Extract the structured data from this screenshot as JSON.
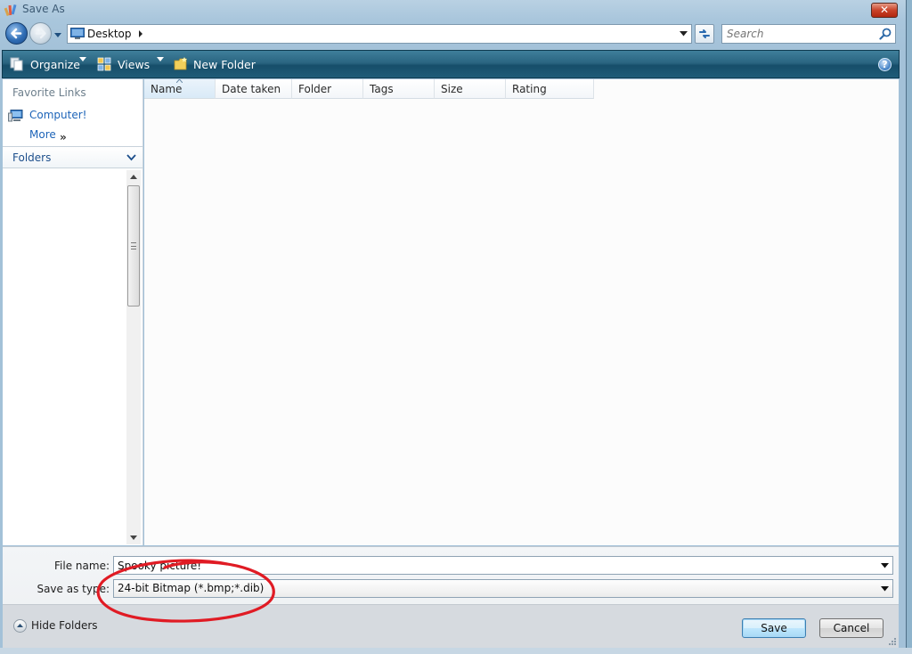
{
  "window": {
    "title": "Save As",
    "colors": {
      "toolbar": "#1f5c78",
      "link": "#1d64b8",
      "close": "#c9432a",
      "annotation": "#e01b24"
    }
  },
  "nav": {
    "back_icon": "back-arrow-icon",
    "forward_icon": "forward-arrow-icon",
    "address": "Desktop",
    "search_placeholder": "Search"
  },
  "toolbar": {
    "organize": "Organize",
    "views": "Views",
    "new_folder": "New Folder",
    "help": "?"
  },
  "sidebar": {
    "favorite_links_header": "Favorite Links",
    "items": [
      {
        "label": "Computer!",
        "icon": "computer-icon"
      }
    ],
    "more": "More",
    "more_chevron": "»",
    "folders": "Folders"
  },
  "file_list": {
    "columns": [
      "Name",
      "Date taken",
      "Folder",
      "Tags",
      "Size",
      "Rating"
    ],
    "sorted_column": "Name",
    "rows": []
  },
  "form": {
    "file_name_label": "File name:",
    "file_name_value": "Spooky picture!",
    "save_as_type_label": "Save as type:",
    "save_as_type_value": "24-bit Bitmap (*.bmp;*.dib)"
  },
  "footer": {
    "hide_folders": "Hide Folders",
    "save": "Save",
    "cancel": "Cancel"
  }
}
